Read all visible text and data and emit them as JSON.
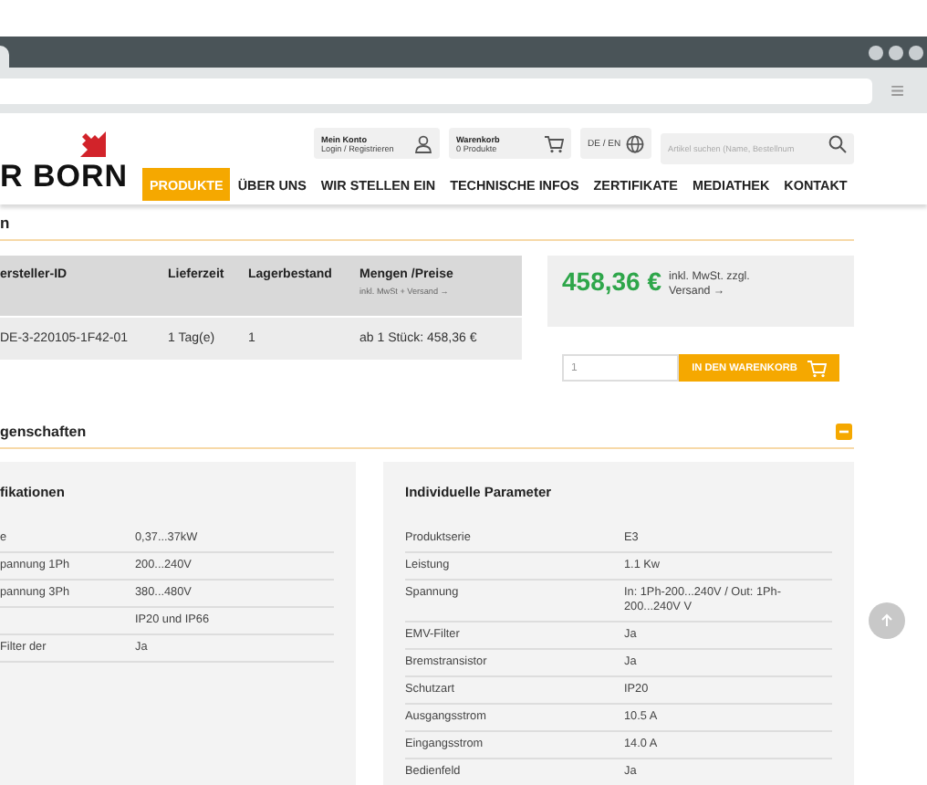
{
  "browser": {
    "menu_icon": "≡"
  },
  "header": {
    "logo": "R BORN",
    "account": {
      "title": "Mein Konto",
      "subtitle": "Login / Registrieren"
    },
    "cart": {
      "title": "Warenkorb",
      "subtitle": "0 Produkte"
    },
    "language": "DE / EN",
    "search": {
      "placeholder": "Artikel suchen (Name, Bestellnum"
    },
    "nav": [
      {
        "label": "PRODUKTE",
        "selected": true
      },
      {
        "label": "ÜBER UNS",
        "selected": false
      },
      {
        "label": "WIR STELLEN EIN",
        "selected": false
      },
      {
        "label": "TECHNISCHE INFOS",
        "selected": false
      },
      {
        "label": "ZERTIFIKATE",
        "selected": false
      },
      {
        "label": "MEDIATHEK",
        "selected": false
      },
      {
        "label": "KONTAKT",
        "selected": false
      }
    ]
  },
  "page_heading": "n",
  "table": {
    "columns": [
      {
        "label": "ersteller-ID"
      },
      {
        "label": "Lieferzeit"
      },
      {
        "label": "Lagerbestand"
      },
      {
        "label": "Mengen /Preise",
        "note": "inkl. MwSt + Versand →"
      }
    ],
    "rows": [
      [
        "DE-3-220105-1F42-01",
        "1 Tag(e)",
        "1",
        "ab 1 Stück: 458,36 €"
      ]
    ]
  },
  "price": {
    "amount": "458,36 €",
    "note": "inkl. MwSt. zzgl. Versand →"
  },
  "order": {
    "quantity": "1",
    "button": "IN DEN WARENKORB"
  },
  "section": {
    "title": "genschaften",
    "expanded": true
  },
  "panels": [
    {
      "title": "fikationen",
      "rows": [
        {
          "label": "e",
          "value": "0,37...37kW"
        },
        {
          "label": "pannung 1Ph",
          "value": "200...240V"
        },
        {
          "label": "pannung 3Ph",
          "value": "380...480V"
        },
        {
          "value": "IP20 und IP66"
        },
        {
          "label": "Filter der",
          "value": "Ja"
        }
      ]
    },
    {
      "title": "Individuelle Parameter",
      "rows": [
        {
          "label": "Produktserie",
          "value": "E3"
        },
        {
          "label": "Leistung",
          "value": "1.1 Kw"
        },
        {
          "label": "Spannung",
          "value": "In: 1Ph-200...240V / Out: 1Ph-200...240V V"
        },
        {
          "label": "EMV-Filter",
          "value": "Ja"
        },
        {
          "label": "Bremstransistor",
          "value": "Ja"
        },
        {
          "label": "Schutzart",
          "value": "IP20"
        },
        {
          "label": "Ausgangsstrom",
          "value": "10.5 A"
        },
        {
          "label": "Eingangsstrom",
          "value": "14.0 A"
        },
        {
          "label": "Bedienfeld",
          "value": "Ja"
        }
      ]
    }
  ]
}
